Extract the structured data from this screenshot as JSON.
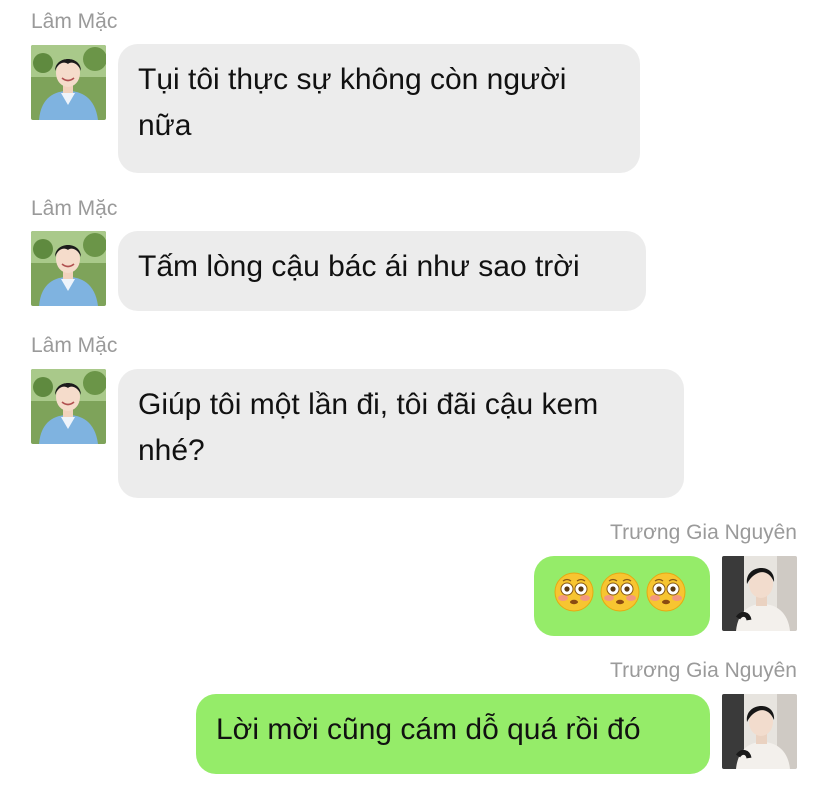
{
  "messages": [
    {
      "sender": "Lâm Mặc",
      "side": "left",
      "text": "Tụi tôi thực sự không còn người nữa"
    },
    {
      "sender": "Lâm Mặc",
      "side": "left",
      "text": "Tấm lòng cậu bác ái như sao trời"
    },
    {
      "sender": "Lâm Mặc",
      "side": "left",
      "text": "Giúp tôi một lần đi, tôi đãi cậu kem nhé?"
    },
    {
      "sender": "Trương Gia Nguyên",
      "side": "right",
      "emoji": [
        "flushed-face-emoji",
        "flushed-face-emoji",
        "flushed-face-emoji"
      ]
    },
    {
      "sender": "Trương Gia Nguyên",
      "side": "right",
      "text": "Lời mời cũng cám dỗ quá rồi đó"
    }
  ],
  "colors": {
    "incoming_bubble": "#ececec",
    "outgoing_bubble": "#95ec69",
    "sender_name": "#9a9a9a"
  }
}
